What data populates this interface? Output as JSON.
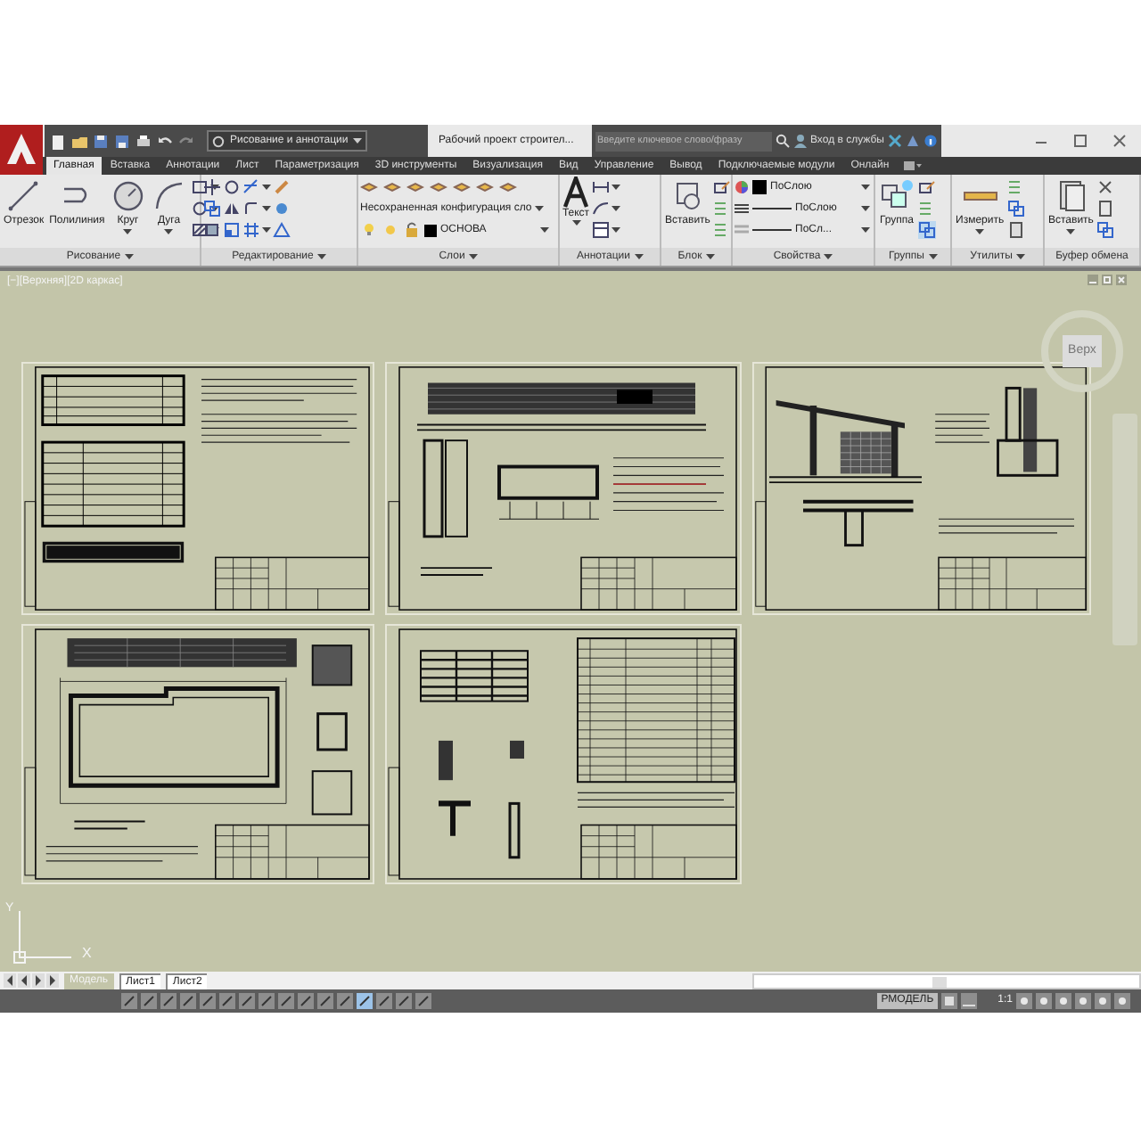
{
  "title_bar": {
    "workspace": "Рисование и аннотации",
    "title": "Рабочий проект строител...",
    "search": {
      "placeholder": "Введите ключевое слово/фразу"
    },
    "sign_in": "Вход в службы"
  },
  "ribbon_tabs": [
    {
      "label": "Главная",
      "selected": true
    },
    {
      "label": "Вставка",
      "selected": false
    },
    {
      "label": "Аннотации",
      "selected": false
    },
    {
      "label": "Лист",
      "selected": false
    },
    {
      "label": "Параметризация",
      "selected": false
    },
    {
      "label": "3D инструменты",
      "selected": false
    },
    {
      "label": "Визуализация",
      "selected": false
    },
    {
      "label": "Вид",
      "selected": false
    },
    {
      "label": "Управление",
      "selected": false
    },
    {
      "label": "Вывод",
      "selected": false
    },
    {
      "label": "Подключаемые модули",
      "selected": false
    },
    {
      "label": "Онлайн",
      "selected": false
    }
  ],
  "ribbon_panels": [
    {
      "title": "Рисование",
      "menu": true,
      "buttons": [
        "Отрезок",
        "Полилиния",
        "Круг",
        "Дуга"
      ]
    },
    {
      "title": "Редактирование",
      "menu": true
    },
    {
      "title": "Слои",
      "menu": true,
      "layer_state": "Несохраненная конфигурация сло",
      "layer": "ОСНОВА"
    },
    {
      "title": "Аннотации",
      "menu": true,
      "buttons": [
        "Текст"
      ]
    },
    {
      "title": "Блок",
      "menu": true,
      "buttons": [
        "Вставить"
      ]
    },
    {
      "title": "Свойства",
      "menu": true,
      "color_setting": "ПоСлою",
      "linetype_setting": "ПоСлою",
      "lineweight_setting": "ПоСл..."
    },
    {
      "title": "Группы",
      "menu": true,
      "buttons": [
        "Группа"
      ]
    },
    {
      "title": "Утилиты",
      "menu": true,
      "buttons": [
        "Измерить"
      ]
    },
    {
      "title": "Буфер обмена",
      "menu": false,
      "buttons": [
        "Вставить"
      ]
    }
  ],
  "viewport": {
    "label": "[−][Верхняя][2D каркас]",
    "viewcube": "Верх",
    "ucs": {
      "x": "X",
      "y": "Y"
    },
    "sheets": [
      {
        "kind": "tables"
      },
      {
        "kind": "facade"
      },
      {
        "kind": "section"
      },
      {
        "kind": "plan"
      },
      {
        "kind": "schedule"
      }
    ]
  },
  "layout_tabs": [
    {
      "label": "Модель",
      "selected": true
    },
    {
      "label": "Лист1",
      "selected": false
    },
    {
      "label": "Лист2",
      "selected": false
    }
  ],
  "status_bar": {
    "space": "РМОДЕЛЬ",
    "scale": "1:1"
  }
}
